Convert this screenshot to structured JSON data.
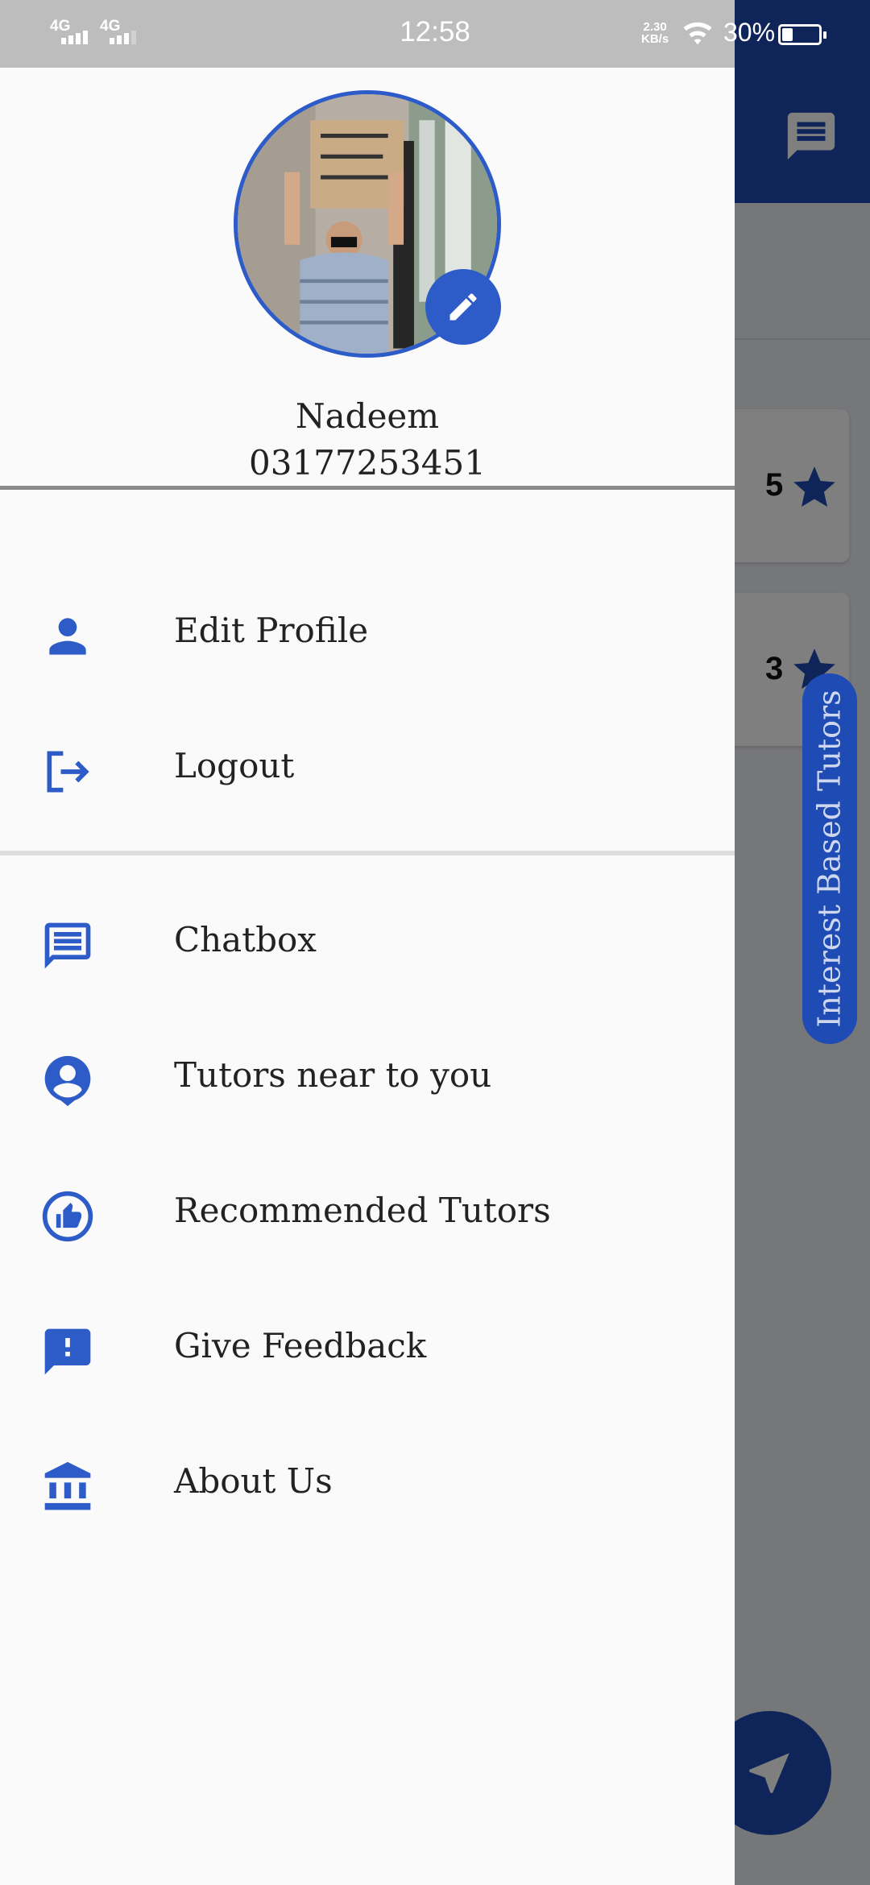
{
  "status_bar": {
    "sim1": "4G",
    "sim2": "4G",
    "time": "12:58",
    "net_speed_value": "2.30",
    "net_speed_unit": "KB/s",
    "battery_percent": "30%"
  },
  "drawer": {
    "user": {
      "name": "Nadeem",
      "phone": "03177253451"
    },
    "menu_section_1": [
      {
        "label": "Edit Profile",
        "icon": "person-icon"
      },
      {
        "label": "Logout",
        "icon": "logout-icon"
      }
    ],
    "menu_section_2": [
      {
        "label": "Chatbox",
        "icon": "chat-icon"
      },
      {
        "label": "Tutors near to you",
        "icon": "person-pin-icon"
      },
      {
        "label": "Recommended Tutors",
        "icon": "thumb-up-icon"
      },
      {
        "label": "Give Feedback",
        "icon": "feedback-icon"
      },
      {
        "label": "About Us",
        "icon": "institution-icon"
      }
    ]
  },
  "background": {
    "ratings": [
      "5",
      "3"
    ],
    "side_tab_label": "Interest Based Tutors"
  },
  "colors": {
    "accent": "#2D5CC8",
    "toolbar": "#1F4BB5",
    "drawer_bg": "#FAFAFA"
  }
}
